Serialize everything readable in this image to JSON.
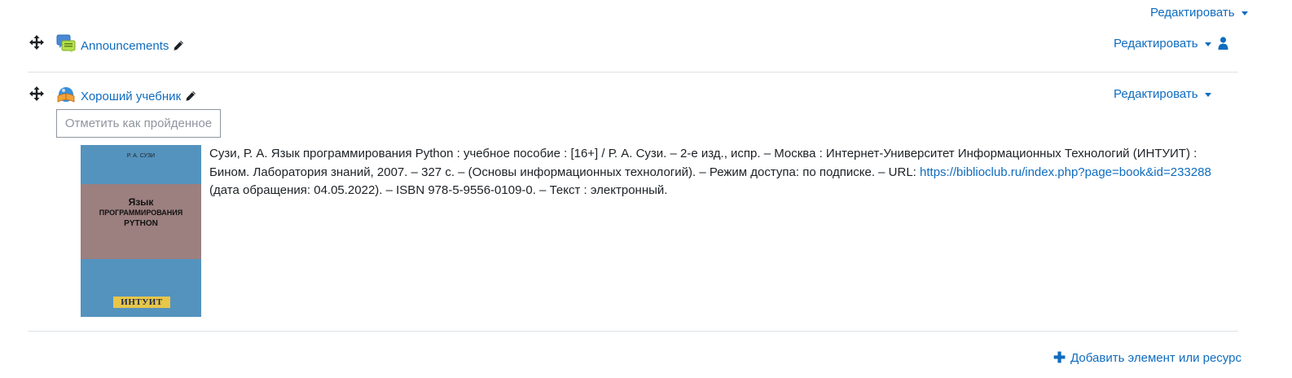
{
  "section": {
    "edit_label": "Редактировать"
  },
  "activities": [
    {
      "name": "Announcements",
      "icon": "forum-icon",
      "edit_label": "Редактировать"
    },
    {
      "name": "Хороший учебник",
      "icon": "book-icon",
      "edit_label": "Редактировать",
      "completion_button": "Отметить как пройденное",
      "cover": {
        "author": "Р. А. СУЗИ",
        "title_line1": "Язык",
        "title_line2": "программирования",
        "title_line3": "Python",
        "publisher": "ИНТУИТ"
      },
      "citation_text_1": "Сузи, Р. А. Язык программирования Python : учебное пособие : [16+] / Р. А. Сузи. – 2-е изд., испр. – Москва : Интернет-Университет Информационных Технологий (ИНТУИТ) : Бином. Лаборатория знаний, 2007. – 327 с. – (Основы информационных технологий). – Режим доступа: по подписке. – URL: ",
      "citation_link": "https://biblioclub.ru/index.php?page=book&id=233288",
      "citation_text_2": " (дата обращения: 04.05.2022). – ISBN 978-5-9556-0109-0. – Текст : электронный."
    }
  ],
  "footer": {
    "add_resource_label": "Добавить элемент или ресурс"
  },
  "colors": {
    "link": "#0f6cbf",
    "text": "#1d2125",
    "divider": "#dee2e6",
    "cover_blue": "#5493be",
    "cover_mauve": "#9c7f7f"
  }
}
